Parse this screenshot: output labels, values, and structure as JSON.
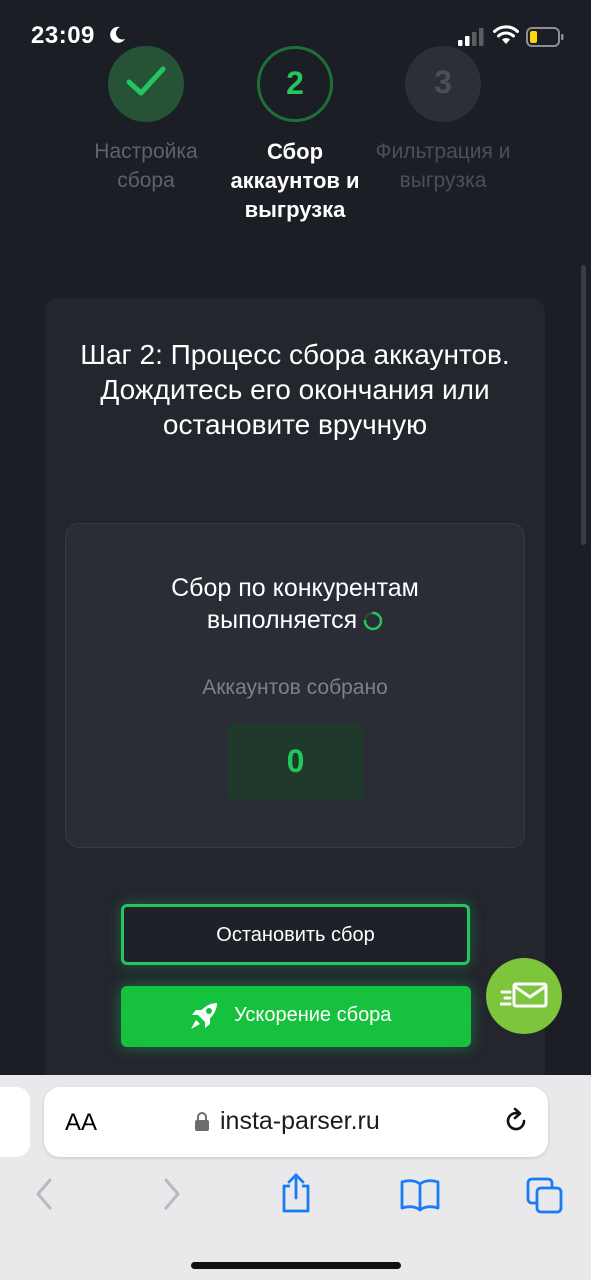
{
  "status_bar": {
    "time": "23:09"
  },
  "steps": [
    {
      "number": "1",
      "label": "Настройка сбора",
      "state": "done"
    },
    {
      "number": "2",
      "label": "Сбор аккаунтов и выгрузка",
      "state": "active"
    },
    {
      "number": "3",
      "label": "Фильтрация и выгрузка",
      "state": "pending"
    }
  ],
  "main": {
    "title": "Шаг 2: Процесс сбора аккаунтов. Дождитесь его окончания или остановите вручную",
    "progress": {
      "status_text": "Сбор по конкурентам выполняется",
      "collected_label": "Аккаунтов собрано",
      "collected_value": "0"
    },
    "stop_button": "Остановить сбор",
    "boost_button": "Ускорение сбора"
  },
  "browser": {
    "text_size_button": "AA",
    "url": "insta-parser.ru"
  },
  "colors": {
    "accent": "#22c55e",
    "button_green": "#16c23d",
    "fab_green": "#7dc63b",
    "background": "#1b1e25",
    "card": "#23262d"
  },
  "icons": [
    "moon-icon",
    "signal-icon",
    "wifi-icon",
    "battery-icon",
    "check-icon",
    "spinner-icon",
    "rocket-icon",
    "send-mail-icon",
    "lock-icon",
    "reload-icon",
    "back-icon",
    "forward-icon",
    "share-icon",
    "bookmarks-icon",
    "tabs-icon"
  ]
}
